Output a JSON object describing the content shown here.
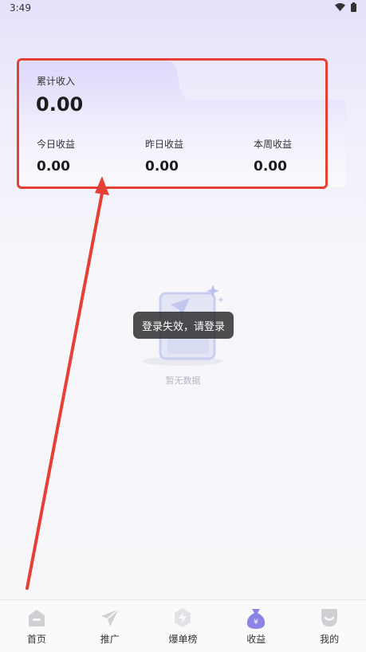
{
  "status_bar": {
    "time": "3:49"
  },
  "earnings_card": {
    "total_label": "累计收入",
    "total_value": "0.00",
    "stats": [
      {
        "label": "今日收益",
        "value": "0.00"
      },
      {
        "label": "昨日收益",
        "value": "0.00"
      },
      {
        "label": "本周收益",
        "value": "0.00"
      }
    ]
  },
  "empty_state": {
    "text": "暂无数据"
  },
  "toast": {
    "text": "登录失效，请登录"
  },
  "tabbar": {
    "items": [
      {
        "label": "首页",
        "icon": "home-icon"
      },
      {
        "label": "推广",
        "icon": "paper-plane-icon"
      },
      {
        "label": "爆单榜",
        "icon": "lightning-badge-icon"
      },
      {
        "label": "收益",
        "icon": "money-bag-icon",
        "active": true
      },
      {
        "label": "我的",
        "icon": "profile-icon"
      }
    ]
  },
  "colors": {
    "accent": "#8b84e6",
    "annotation_red": "#e53f36",
    "icon_inactive": "#cfcfd4"
  }
}
